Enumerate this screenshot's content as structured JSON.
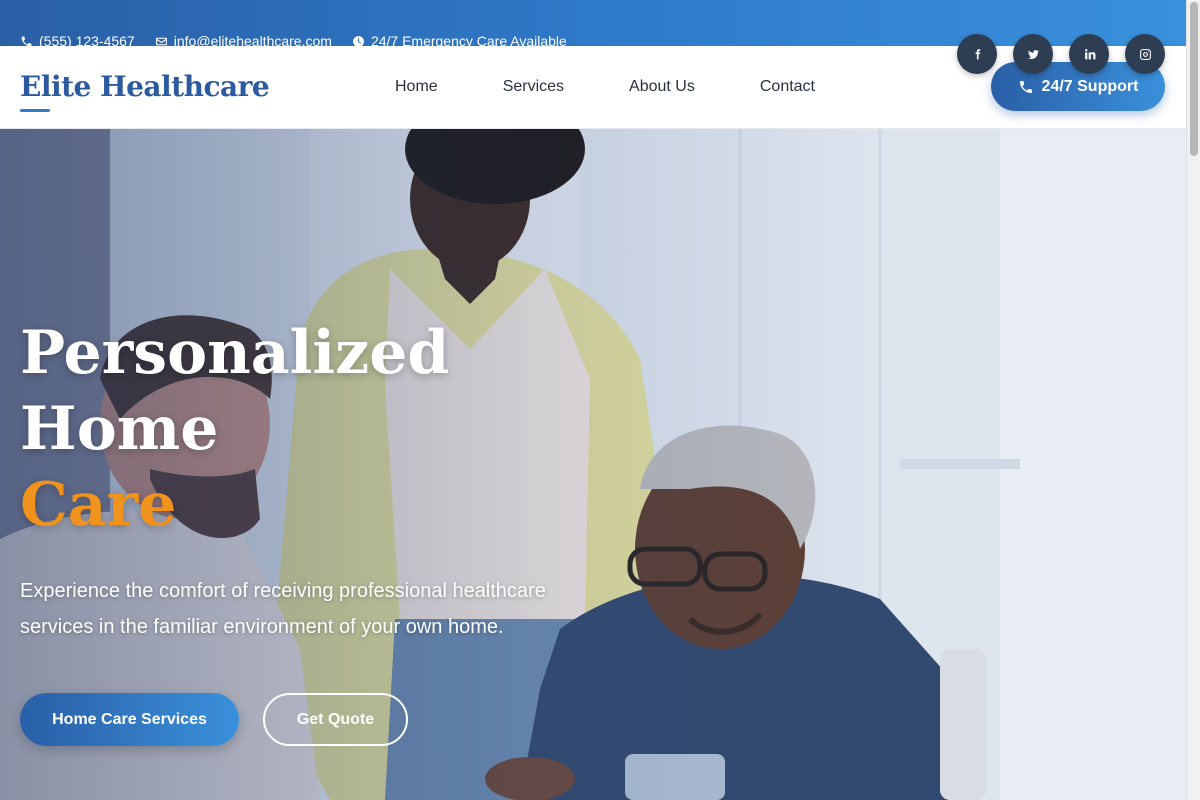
{
  "topbar": {
    "phone": "(555) 123-4567",
    "email": "info@elitehealthcare.com",
    "emergency": "24/7 Emergency Care Available"
  },
  "header": {
    "logo": "Elite Healthcare",
    "nav": [
      "Home",
      "Services",
      "About Us",
      "Contact"
    ],
    "support_label": "24/7 Support"
  },
  "socials": [
    {
      "icon": "facebook-icon"
    },
    {
      "icon": "twitter-icon"
    },
    {
      "icon": "linkedin-icon"
    },
    {
      "icon": "instagram-icon"
    }
  ],
  "hero": {
    "title_line1": "Personalized",
    "title_line2": "Home",
    "title_line3": "Care",
    "subtitle": "Experience the comfort of receiving professional healthcare services in the familiar environment of your own home.",
    "primary_button": "Home Care Services",
    "secondary_button": "Get Quote"
  },
  "colors": {
    "brand_blue": "#2a5fa6",
    "accent_orange": "#f0921c",
    "social_bg": "#2f3d52"
  }
}
